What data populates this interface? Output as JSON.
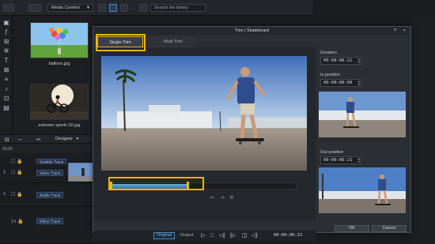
{
  "library": {
    "dropdown_value": "Media Content",
    "search_placeholder": "Search the library",
    "items": [
      {
        "caption": "balloon.jpg"
      },
      {
        "caption": "extreme sports 02.jpg"
      }
    ]
  },
  "timeline": {
    "designer_label": "Designer",
    "ruler_label": "00:00",
    "tracks": [
      {
        "num": "",
        "label": "Subtitle Track"
      },
      {
        "num": "1.",
        "label": "Video Track"
      },
      {
        "num": "1.",
        "label": "Audio Track"
      },
      {
        "num": "",
        "label": "Effect Track"
      }
    ]
  },
  "dialog": {
    "title": "Trim | Skateboard",
    "help": "?",
    "close": "×",
    "tabs": {
      "single": "Single Trim",
      "multi": "Multi Trim"
    },
    "trim_in_fraction": 0.0,
    "trim_out_fraction": 0.42,
    "view": {
      "original": "Original",
      "output": "Output"
    },
    "timecode": "00:00:06:21",
    "duration_label": "Duration",
    "duration_value": "00:00:06:21",
    "in_label": "In position",
    "in_value": "00:00:00:00",
    "out_label": "Out position",
    "out_value": "00:00:06:21",
    "ok": "OK",
    "cancel": "Cancel"
  },
  "icons": {
    "play": "▷",
    "stop": "□",
    "prev_frame": "◁|",
    "next_frame": "|▷",
    "snapshot": "◫",
    "volume": "◁)"
  }
}
